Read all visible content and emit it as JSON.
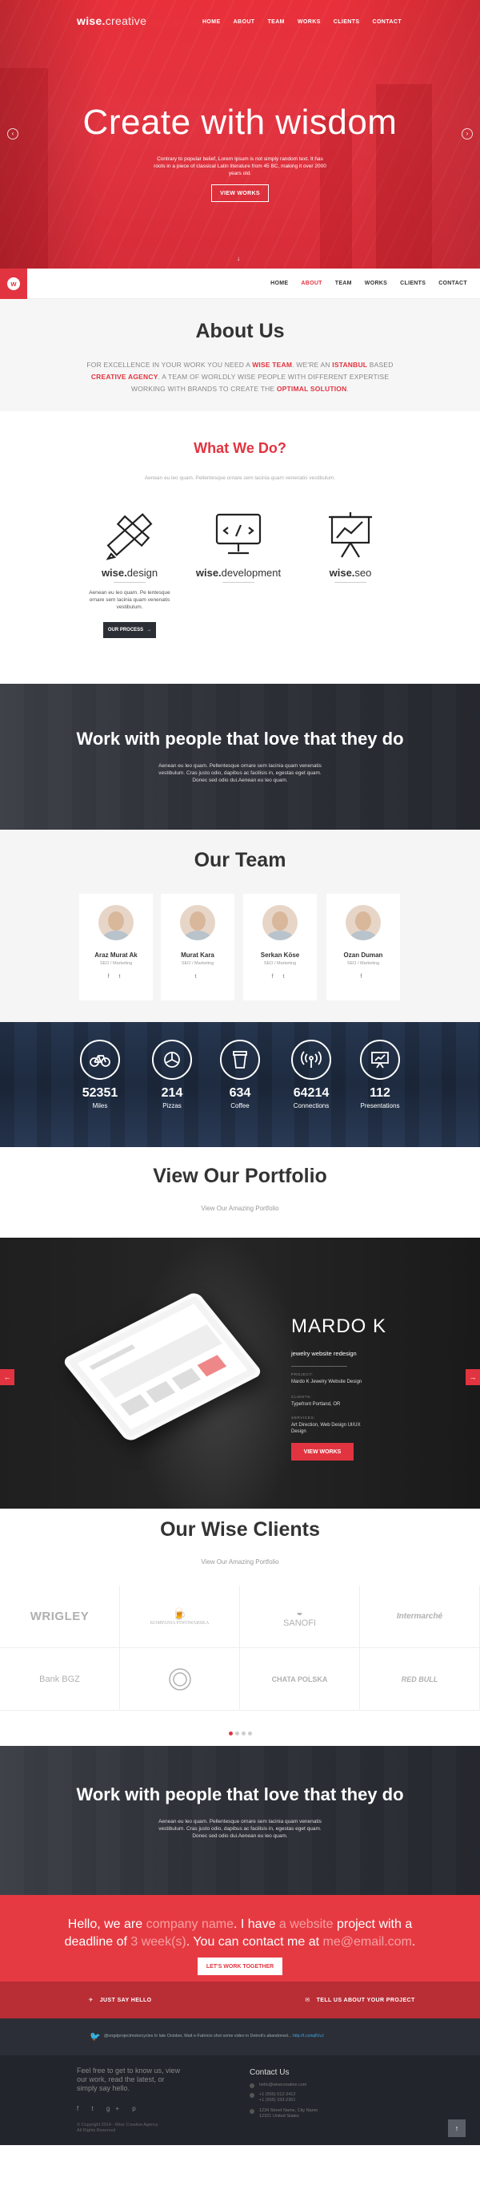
{
  "header": {
    "logo_bold": "wise.",
    "logo_light": "creative",
    "nav": [
      "HOME",
      "ABOUT",
      "TEAM",
      "WORKS",
      "CLIENTS",
      "CONTACT"
    ]
  },
  "hero": {
    "title": "Create with wisdom",
    "text": "Contrary to popular belief, Lorem Ipsum is not simply random text. It has roots in a piece of classical Latin literature from 45 BC, making it over 2000 years old.",
    "button": "VIEW WORKS"
  },
  "sticky_nav": {
    "logo_letter": "w",
    "items": [
      "HOME",
      "ABOUT",
      "TEAM",
      "WORKS",
      "CLIENTS",
      "CONTACT"
    ],
    "active": "ABOUT"
  },
  "about": {
    "title": "About Us",
    "p1": "FOR EXCELLENCE IN YOUR WORK YOU NEED A",
    "h1": "WISE TEAM",
    "p2": ". WE'RE AN",
    "h2": "ISTANBUL",
    "p3": "BASED",
    "h3": "CREATIVE AGENCY",
    "p4": ". A TEAM OF WORLDLY WISE PEOPLE WITH DIFFERENT EXPERTISE WORKING WITH BRANDS TO CREATE THE",
    "h4": "OPTIMAL SOLUTION",
    "p5": "."
  },
  "what_we_do": {
    "title": "What We Do?",
    "subtitle": "Aenean eu leo quam. Pellentesque ornare sem lacinia quam venenatis vestibulum.",
    "services": [
      {
        "bold": "wise.",
        "light": "design",
        "desc": "Aenean eu leo quam. Pe lentesque ornare sem lacinia quam venenatis vestibulum.",
        "button": "OUR PROCESS"
      },
      {
        "bold": "wise.",
        "light": "development"
      },
      {
        "bold": "wise.",
        "light": "seo"
      }
    ]
  },
  "banner1": {
    "title": "Work with people that love that they do",
    "text": "Aenean eu leo quam. Pellentesque ornare sem lacinia quam venenatis vestibulum. Cras justo odio, dapibus ac facilisis in, egestas eget quam. Donec sed odio dui.Aenean eu leo quam."
  },
  "team": {
    "title": "Our Team",
    "members": [
      {
        "name": "Araz Murat Ak",
        "role": "SEO / Marketing",
        "social": "f  t"
      },
      {
        "name": "Murat Kara",
        "role": "SEO / Marketing",
        "social": "t"
      },
      {
        "name": "Serkan Köse",
        "role": "SEO / Marketing",
        "social": "f  t"
      },
      {
        "name": "Ozan Duman",
        "role": "SEO / Marketing",
        "social": "f"
      }
    ]
  },
  "stats": [
    {
      "value": "52351",
      "label": "Miles",
      "icon": "bicycle-icon"
    },
    {
      "value": "214",
      "label": "Pizzas",
      "icon": "pizza-icon"
    },
    {
      "value": "634",
      "label": "Coffee",
      "icon": "coffee-icon"
    },
    {
      "value": "64214",
      "label": "Connections",
      "icon": "wifi-icon"
    },
    {
      "value": "112",
      "label": "Presentations",
      "icon": "presentation-icon"
    }
  ],
  "portfolio": {
    "title": "View Our Portfolio",
    "subtitle": "View Our Amazing Portfolio",
    "project": "MARDO K",
    "tagline": "jewelry website redesign",
    "project_label": "PROJECT:",
    "project_value": "Mardo K Jewelry Website Design",
    "client_label": "CLIENTS:",
    "client_value": "Typefront Portland, OR",
    "services_label": "SERVICES:",
    "services_value": "Art Direction, Web Design UI/UX Design",
    "button": "VIEW WORKS"
  },
  "clients": {
    "title": "Our Wise Clients",
    "subtitle": "View Our Amazing Portfolio",
    "logos": [
      "WRIGLEY",
      "KOMPANIA PIWOWARSKA",
      "SANOFI",
      "Intermarché",
      "Bank BGZ",
      "seal",
      "CHATA POLSKA",
      "RED BULL"
    ]
  },
  "contact": {
    "t1": "Hello, we are",
    "company": "company name",
    "t2": ". I have",
    "website": "a website",
    "t3": "project with a deadline of",
    "weeks": "3 week(s)",
    "t4": ". You can contact me at",
    "email": "me@email.com",
    "t5": ".",
    "button": "LET'S WORK TOGETHER",
    "left_cta": "JUST SAY HELLO",
    "right_cta": "TELL US ABOUT YOUR PROJECT"
  },
  "twitter": {
    "handle": "@ongdprojectmotorcycles",
    "text": "In late October, Matt e-Fabricio shot some video in Detroit's abandoned... ",
    "link": "http://t.co/wjfUvJ"
  },
  "footer": {
    "blurb": "Feel free to get to know us, view our work, read the latest, or simply say hello.",
    "copyright": "© Copyright 2014 - Wise Creative Agency",
    "rights": "All Rights Reserved",
    "contact_title": "Contact Us",
    "email": "hello@wisecreative.com",
    "phone1": "+1 (555) 012-3412",
    "phone2": "+1 (555) 333-2361",
    "address": "1234 Street Name, City Name 12321 United States",
    "top": "↑"
  }
}
